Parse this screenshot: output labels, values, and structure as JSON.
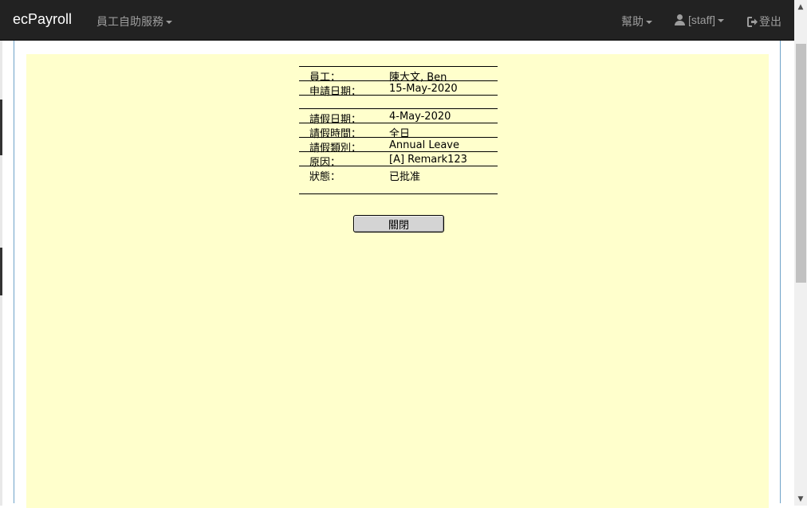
{
  "navbar": {
    "brand": "ecPayroll",
    "menu_self_service": "員工自助服務",
    "help": "幫助",
    "user": "[staff]",
    "logout": "登出"
  },
  "leave_detail": {
    "rows": [
      {
        "label": "員工：",
        "value": "陳大文, Ben"
      },
      {
        "label": "申請日期：",
        "value": "15-May-2020"
      },
      {
        "label": "請假日期：",
        "value": "4-May-2020"
      },
      {
        "label": "請假時間：",
        "value": "全日"
      },
      {
        "label": "請假類別：",
        "value": "Annual Leave"
      },
      {
        "label": "原因：",
        "value": "[A] Remark123"
      },
      {
        "label": "狀態：",
        "value": "已批准"
      }
    ],
    "close_button": "關閉"
  },
  "colors": {
    "navbar_bg": "#222222",
    "nav_text": "#9d9d9d",
    "panel_bg": "#ffffcc",
    "modal_border": "#6fa3c9"
  },
  "icons": [
    "user-icon",
    "logout-icon",
    "chevron-up-icon",
    "chevron-down-icon"
  ]
}
